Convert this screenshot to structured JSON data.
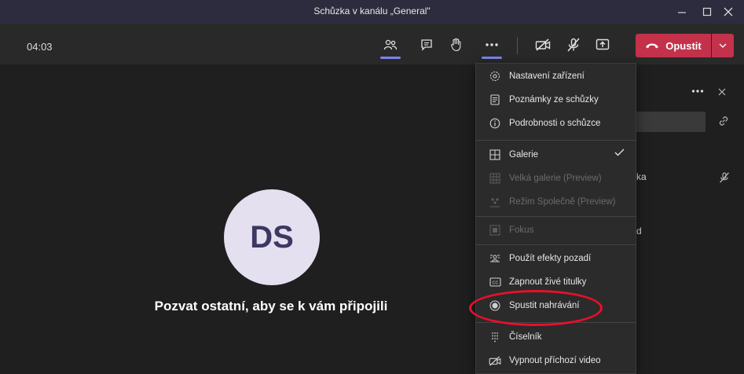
{
  "window": {
    "title": "Schůzka v kanálu „General\""
  },
  "toolbar": {
    "timer": "04:03",
    "leave_label": "Opustit"
  },
  "stage": {
    "avatar_initials": "DS",
    "invite_text": "Pozvat ostatní, aby se k vám připojili"
  },
  "right_panel": {
    "participant_fragment_1": "ka",
    "participant_fragment_2": "d"
  },
  "menu": {
    "items": [
      {
        "label": "Nastavení zařízení",
        "icon": "gear-icon",
        "enabled": true
      },
      {
        "label": "Poznámky ze schůzky",
        "icon": "notes-icon",
        "enabled": true
      },
      {
        "label": "Podrobnosti o schůzce",
        "icon": "info-icon",
        "enabled": true
      },
      {
        "label": "Galerie",
        "icon": "gallery-icon",
        "enabled": true,
        "checked": true
      },
      {
        "label": "Velká galerie (Preview)",
        "icon": "large-gallery-icon",
        "enabled": false
      },
      {
        "label": "Režim Společně (Preview)",
        "icon": "together-mode-icon",
        "enabled": false
      },
      {
        "label": "Fokus",
        "icon": "focus-icon",
        "enabled": false
      },
      {
        "label": "Použít efekty pozadí",
        "icon": "background-effects-icon",
        "enabled": true
      },
      {
        "label": "Zapnout živé titulky",
        "icon": "captions-icon",
        "enabled": true
      },
      {
        "label": "Spustit nahrávání",
        "icon": "record-icon",
        "enabled": true
      },
      {
        "label": "Číselník",
        "icon": "dialpad-icon",
        "enabled": true
      },
      {
        "label": "Vypnout příchozí video",
        "icon": "video-off-icon",
        "enabled": true
      }
    ]
  },
  "colors": {
    "accent": "#7b83eb",
    "leave": "#c4314b",
    "highlight_oval": "#e8102a"
  }
}
